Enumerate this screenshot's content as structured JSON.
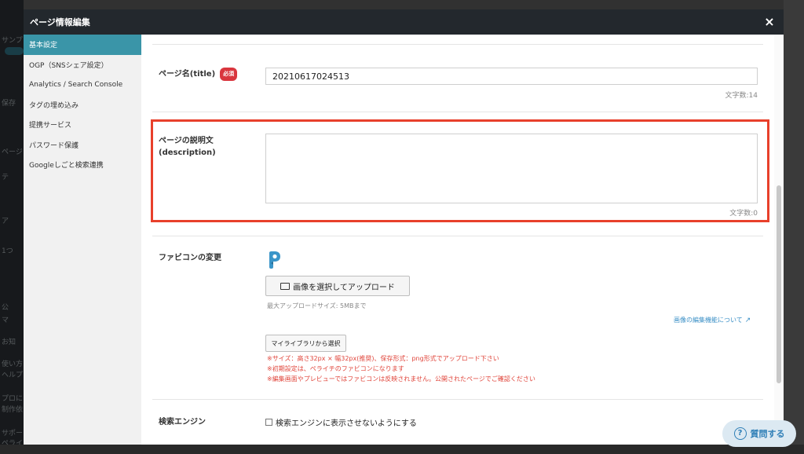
{
  "background": {
    "left_fragments": [
      "サンプ",
      "保存",
      "ページ",
      "テ",
      "ア",
      "1つ",
      "公",
      "マ",
      "お知",
      "使い方",
      "ヘルプ",
      "プロに",
      "制作依",
      "サポー",
      "ペライ"
    ]
  },
  "modal": {
    "title": "ページ情報編集",
    "close_label": "×"
  },
  "sidebar": {
    "items": [
      {
        "label": "基本設定",
        "active": true
      },
      {
        "label": "OGP（SNSシェア設定）",
        "active": false
      },
      {
        "label": "Analytics / Search Console",
        "active": false
      },
      {
        "label": "タグの埋め込み",
        "active": false
      },
      {
        "label": "提携サービス",
        "active": false
      },
      {
        "label": "パスワード保護",
        "active": false
      },
      {
        "label": "Googleしごと検索連携",
        "active": false
      }
    ]
  },
  "form": {
    "title_field": {
      "label": "ページ名(title)",
      "required_badge": "必須",
      "value": "20210617024513",
      "count": "文字数:14"
    },
    "description_field": {
      "label_line1": "ページの説明文",
      "label_line2": "(description)",
      "value": "",
      "count": "文字数:0"
    },
    "favicon": {
      "label": "ファビコンの変更",
      "upload_button": "画像を選択してアップロード",
      "max_size": "最大アップロードサイズ: 5MBまで",
      "edit_link": "画像の編集機能について",
      "library_button": "マイライブラリから選択",
      "notes": [
        "※サイズ：高さ32px × 幅32px(推奨)、保存形式：png形式でアップロード下さい",
        "※初期設定は、ペライチのファビコンになります",
        "※編集画面やプレビューではファビコンは反映されません。公開されたページでご確認ください"
      ]
    },
    "search_engine": {
      "label": "検索エンジン",
      "checkbox_label": "検索エンジンに表示させないようにする",
      "checked": false
    }
  },
  "help_button": {
    "icon": "question-circle-icon",
    "label": "質問する"
  },
  "colors": {
    "header_bg": "#23282d",
    "sidebar_active": "#3a95a8",
    "highlight_border": "#e8402b",
    "required_badge": "#d9363e",
    "note_red": "#e0443a",
    "link_blue": "#3a8fc6",
    "help_blue": "#2f7fb7"
  }
}
